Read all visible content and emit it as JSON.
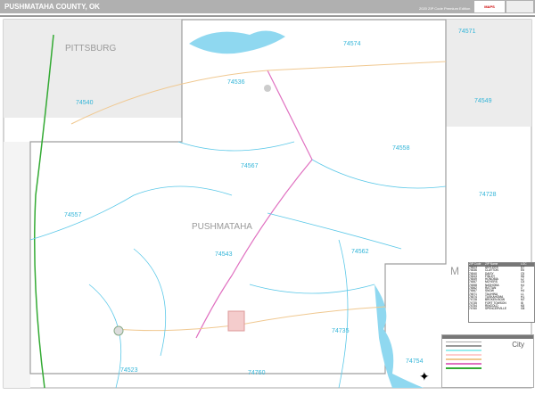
{
  "header": {
    "title": "PUSHMATAHA COUNTY, OK",
    "edition": "2020 ZIP Code Premium Edition",
    "logo": "MAPS"
  },
  "map": {
    "county_label": "PUSHMATAHA",
    "neighbor_labels": [
      "PITTSBURG",
      "M"
    ],
    "zip_labels": [
      "74574",
      "74571",
      "74536",
      "74540",
      "74549",
      "74558",
      "74567",
      "74557",
      "74728",
      "74543",
      "74562",
      "74735",
      "74754",
      "74523",
      "74760"
    ],
    "colors": {
      "zip_boundary": "#5bc8e8",
      "water": "#8fd8f0",
      "highway": "#e070c0",
      "road": "#f0c890",
      "county": "#9e9e9e"
    }
  },
  "zip_table": {
    "headers": [
      "ZIP Code",
      "ZIP Name",
      "LOC"
    ],
    "rows": [
      [
        "74523",
        "ANTLERS",
        "D7"
      ],
      [
        "74536",
        "CLAYTON",
        "E6"
      ],
      [
        "74540",
        "DAISY",
        "C5"
      ],
      [
        "74543",
        "FINLEY",
        "H6"
      ],
      [
        "74549",
        "HONOBIA",
        "L2"
      ],
      [
        "74557",
        "MOYERS",
        "C5"
      ],
      [
        "74558",
        "NASHOBA",
        "K4"
      ],
      [
        "74562",
        "RATTAN",
        "I7"
      ],
      [
        "74567",
        "SNOW",
        "H4"
      ],
      [
        "74571",
        "TALIHINA",
        "L1"
      ],
      [
        "74574",
        "TUSKAHOMA",
        "H1"
      ],
      [
        "74728",
        "BROKEN BOW",
        "M7"
      ],
      [
        "74735",
        "FORT TOWSON",
        "I8"
      ],
      [
        "74754",
        "RINGOLD",
        "K8"
      ],
      [
        "74760",
        "SPENCERVILLE",
        "G8"
      ]
    ]
  },
  "legend": {
    "city_label": "City"
  }
}
